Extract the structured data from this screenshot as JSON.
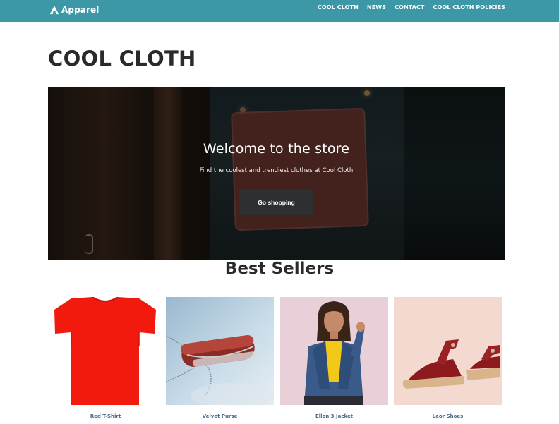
{
  "header": {
    "logo_text": "Apparel",
    "nav": [
      "COOL CLOTH",
      "NEWS",
      "CONTACT",
      "COOL CLOTH POLICIES"
    ]
  },
  "page": {
    "title": "COOL CLOTH"
  },
  "hero": {
    "title": "Welcome to the store",
    "subtitle": "Find the coolest and trendiest clothes at Cool Cloth",
    "button_label": "Go shopping"
  },
  "best_sellers": {
    "title": "Best Sellers",
    "products": [
      {
        "name": "Red T-Shirt"
      },
      {
        "name": "Velvet Purse"
      },
      {
        "name": "Ellen 3 Jacket"
      },
      {
        "name": "Leor Shoes"
      }
    ]
  },
  "colors": {
    "header_bg": "#3c97a7",
    "button_bg": "#2e2f31",
    "product_link": "#4a6b8a"
  }
}
